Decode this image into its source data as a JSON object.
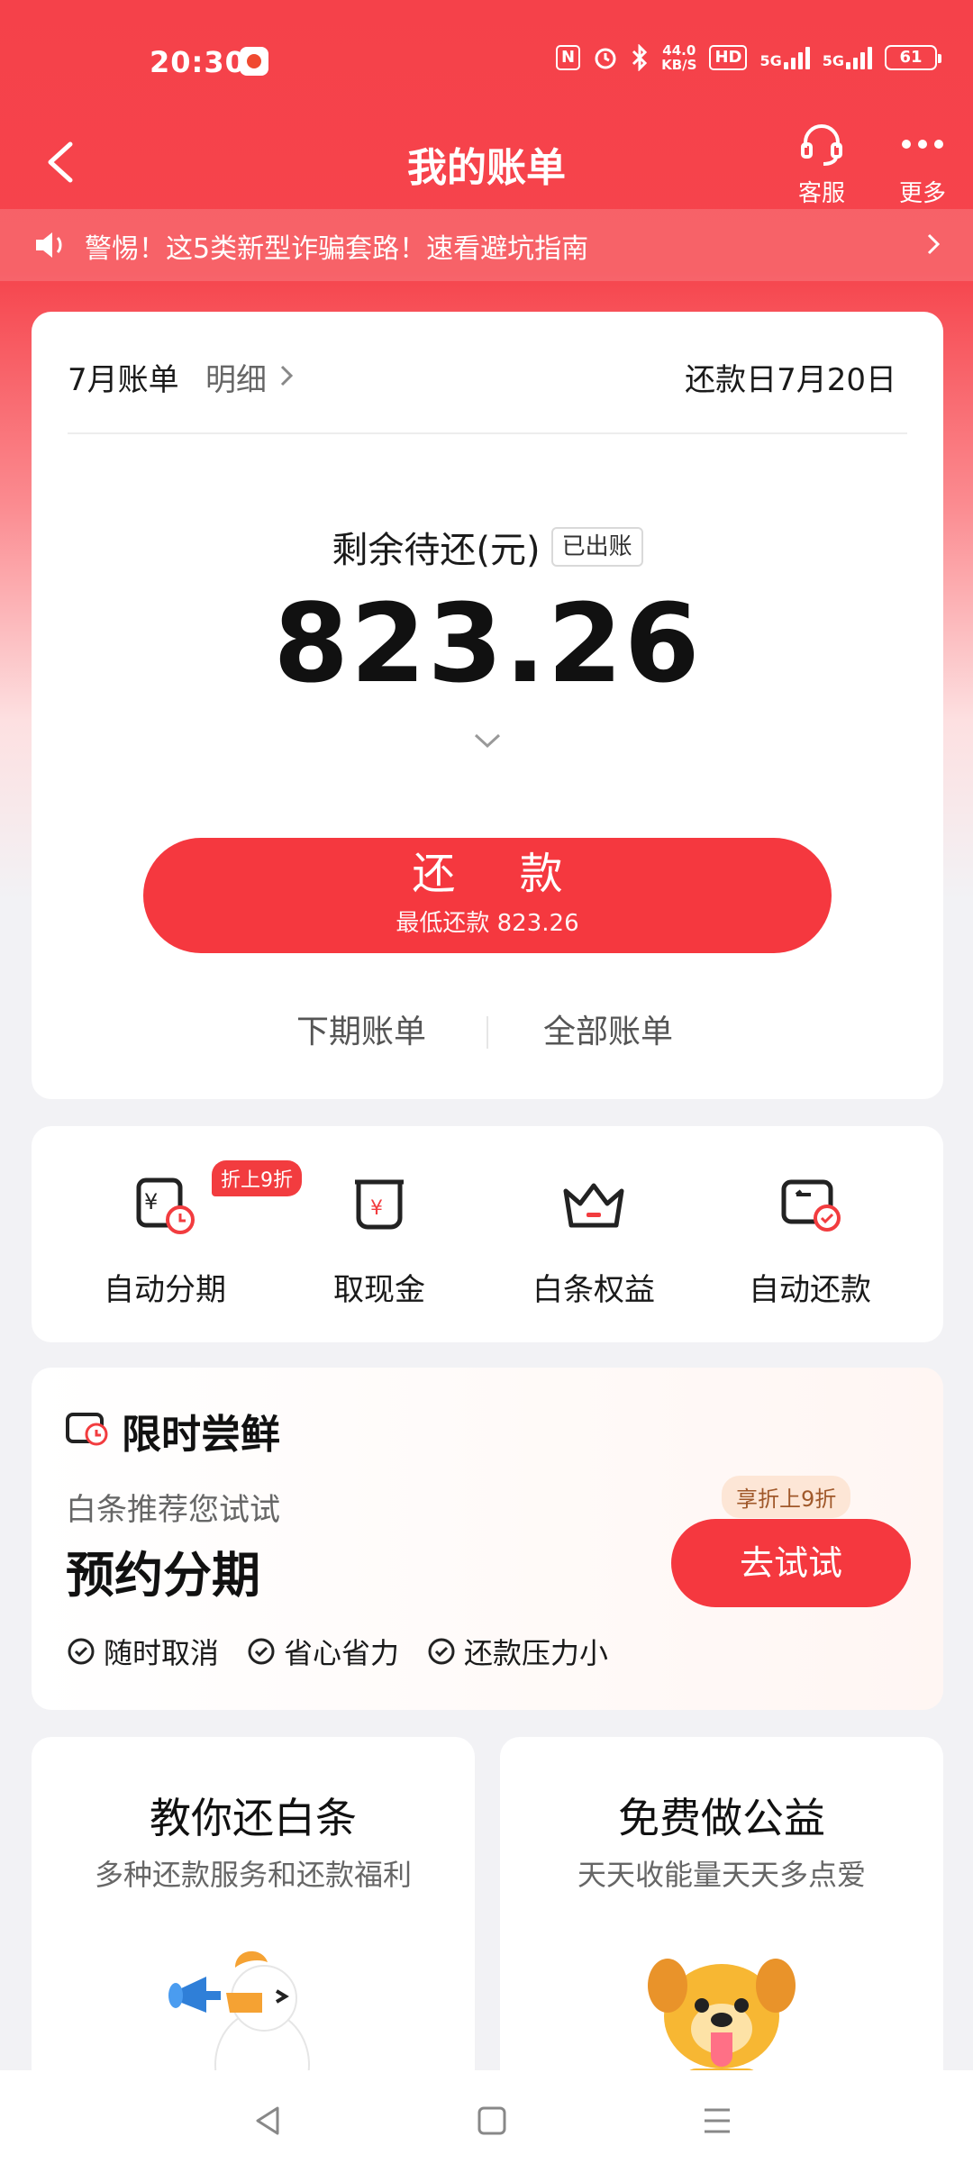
{
  "status_bar": {
    "time": "20:30",
    "nfc": "N",
    "speed_value": "44.0",
    "speed_unit": "KB/S",
    "hd": "HD",
    "net1": "5G",
    "net2": "5G",
    "battery": "61"
  },
  "nav": {
    "title": "我的账单",
    "service_label": "客服",
    "more_label": "更多"
  },
  "notice": {
    "text": "警惕！这5类新型诈骗套路！速看避坑指南"
  },
  "bill": {
    "month": "7月账单",
    "detail": "明细",
    "due_date": "还款日7月20日",
    "remaining_label": "剩余待还(元)",
    "status_badge": "已出账",
    "amount": "823.26",
    "repay_label": "还 款",
    "min_repay": "最低还款 823.26",
    "next_bill": "下期账单",
    "all_bills": "全部账单"
  },
  "quick_actions": {
    "discount_badge": "折上9折",
    "items": [
      {
        "label": "自动分期",
        "icon": "installment-icon"
      },
      {
        "label": "取现金",
        "icon": "cash-icon"
      },
      {
        "label": "白条权益",
        "icon": "crown-icon"
      },
      {
        "label": "自动还款",
        "icon": "auto-repay-icon"
      }
    ]
  },
  "offer": {
    "title": "限时尝鲜",
    "subtitle": "白条推荐您试试",
    "name": "预约分期",
    "discount": "享折上9折",
    "button": "去试试",
    "features": [
      "随时取消",
      "省心省力",
      "还款压力小"
    ]
  },
  "promos": [
    {
      "title": "教你还白条",
      "subtitle": "多种还款服务和还款福利",
      "art": "duck-mascot"
    },
    {
      "title": "免费做公益",
      "subtitle": "天天收能量天天多点爱",
      "art": "dog-mascot"
    }
  ],
  "colors": {
    "brand_red": "#f5383f",
    "header_red": "#f5414a"
  }
}
